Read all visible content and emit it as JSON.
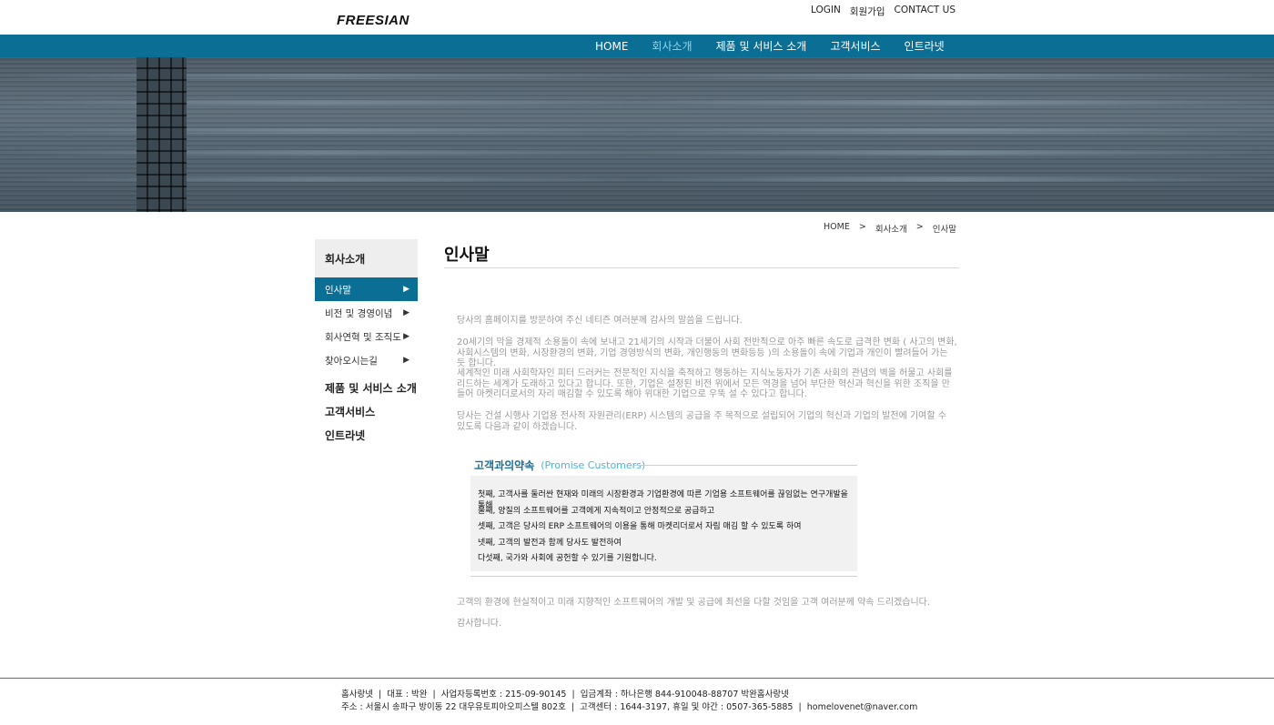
{
  "header": {
    "logo": "FREESIAN",
    "links": [
      "LOGIN",
      "회원가입",
      "CONTACT US"
    ]
  },
  "nav": {
    "items": [
      "HOME",
      "회사소개",
      "제품 및 서비스 소개",
      "고객서비스",
      "인트라넷"
    ],
    "active": "회사소개"
  },
  "breadcrumb": {
    "items": [
      "HOME",
      ">",
      "회사소개",
      ">",
      "인사말"
    ]
  },
  "sidebar": {
    "heading": "회사소개",
    "sub_items": [
      {
        "label": "인사말",
        "arrow": "▶"
      },
      {
        "label": "비전 및 경영이념",
        "arrow": "▶"
      },
      {
        "label": "회사연혁 및 조직도",
        "arrow": "▶"
      },
      {
        "label": "찾아오시는길",
        "arrow": "▶"
      }
    ],
    "main_items": [
      "제품 및 서비스 소개",
      "고객서비스",
      "인트라넷"
    ]
  },
  "content": {
    "title": "인사말",
    "paragraphs": [
      "당사의 홈페이지를 방문하여 주신 네티즌 여러분께 감사의 말씀을 드립니다.",
      "20세기의 막을 경제적 소용돌이 속에 보내고 21세기의 시작과 더불어 사회 전반적으로 아주 빠른 속도로 급격한 변화 ( 사고의 변화, 사회시스템의 변화, 시장환경의 변화, 기업 경영방식의 변화, 개인행동의 변화등등 )의 소용돌이 속에 기업과 개인이 빨려들어 가는 듯 합니다.",
      "세계적인 미래 사회학자인 피터 드러커는 전문적인 지식을 축적하고 행동하는 지식노동자가 기존 사회의 관념의 벽을 허물고 사회를 리드하는 세계가 도래하고 있다고 합니다. 또한, 기업은 설정된 비전 위에서 모든 역경을 넘어 부단한 혁신과 혁신을 위한 조직을 만들어 마켓리더로서의 자리 매김할 수 있도록 해야 위대한 기업으로 우뚝 설 수 있다고 합니다.",
      "당사는 건설 시행사 기업용 전사적 자원관리(ERP) 시스템의 공급을 주 목적으로 설립되어 기업의 혁신과 기업의 발전에 기여할 수 있도록 다음과 같이 하겠습니다."
    ],
    "promise": {
      "title_ko": "고객과의약속",
      "title_en": "(Promise Customers)",
      "items": [
        "첫째, 고객사를 둘러싼 현재와 미래의 시장환경과 기업환경에 따른 기업용 소프트웨어를 끊임없는 연구개발을 통해",
        "둘째, 양질의 소프트웨어를 고객에게 지속적이고 안정적으로 공급하고",
        "셋째, 고객은 당사의 ERP 소프트웨어의 이용을 통해 마켓리더로서 자림 매김 할 수 있도록 하여",
        "넷째, 고객의 발전과 함께 당사도 발전하여",
        "다섯째, 국가와 사회에 공헌할 수 있기를 기원합니다."
      ]
    },
    "closing": [
      "고객의 환경에 현실적이고 미래 지향적인 소프트웨어의 개발 및 공급에 최선을 다할 것임을 고객 여러분께 약속 드리겠습니다.",
      "감사합니다."
    ]
  },
  "footer": {
    "line1": "홈사랑넷  |  대표 : 박완  |  사업자등록번호 : 215-09-90145  |  입금계좌 : 하나은행 844-910048-88707 박완홈사랑넷",
    "line2": "주소 : 서울시 송파구 방이동 22 대우유토피아오피스텔 802호  |  고객센터 : 1644-3197, 휴일 및 야간 : 0507-365-5885  |  homelovenet@naver.com"
  }
}
